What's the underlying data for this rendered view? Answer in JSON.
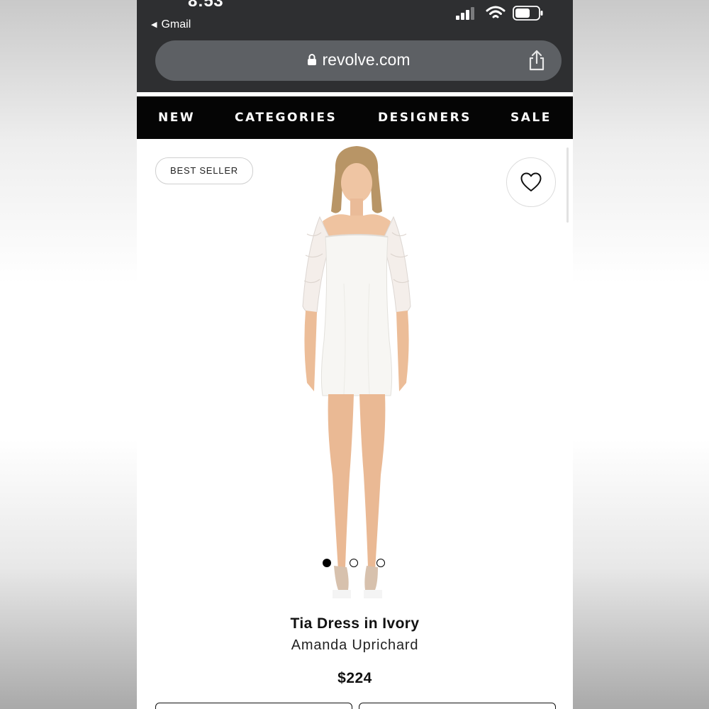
{
  "status_bar": {
    "time": "8:53",
    "back_app": "Gmail"
  },
  "browser": {
    "url": "revolve.com"
  },
  "nav": {
    "items": [
      "NEW",
      "CATEGORIES",
      "DESIGNERS",
      "SALE"
    ]
  },
  "product": {
    "badge": "BEST SELLER",
    "name": "Tia Dress in Ivory",
    "designer": "Amanda Uprichard",
    "price": "$224",
    "image_count": 3,
    "active_image_index": 0
  },
  "icons": {
    "back": "back-triangle-icon",
    "signal": "cellular-signal-icon",
    "wifi": "wifi-icon",
    "battery": "battery-icon",
    "lock": "lock-icon",
    "share": "share-icon",
    "wishlist": "heart-icon"
  },
  "colors": {
    "status_bar_bg": "#2e2f31",
    "url_pill_bg": "#5d6064",
    "nav_bg": "#050505",
    "text_primary": "#111111"
  }
}
